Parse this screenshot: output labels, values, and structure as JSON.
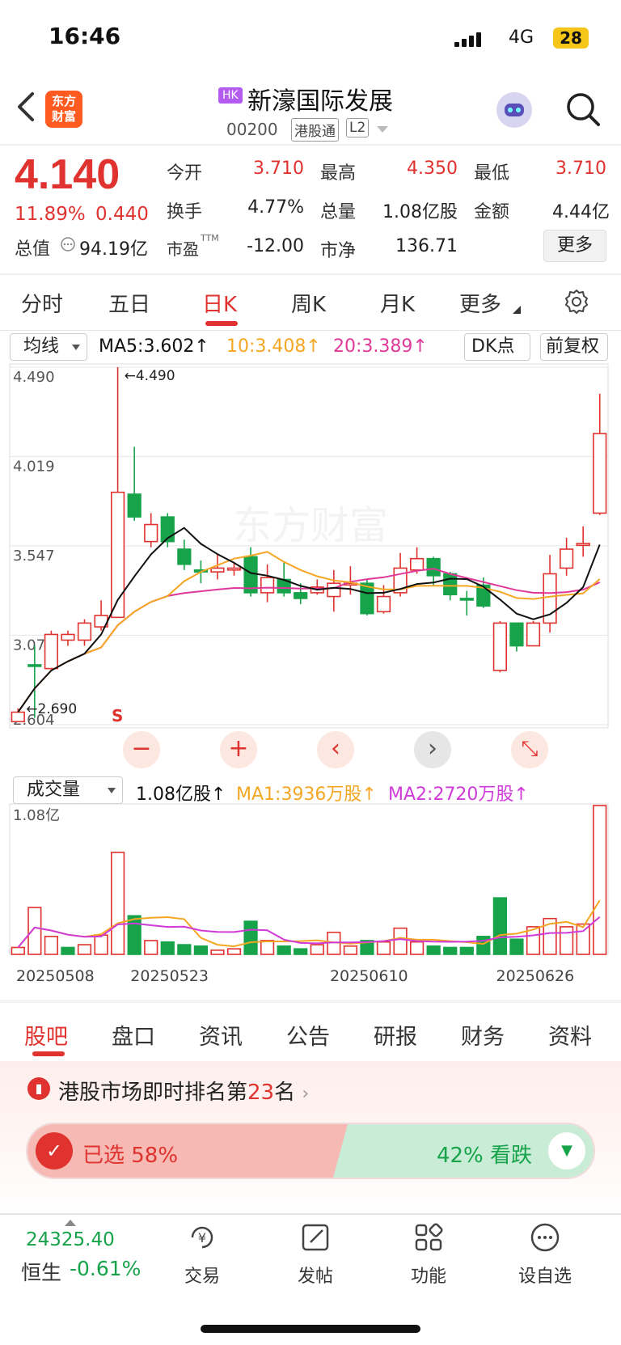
{
  "status_bar": {
    "time": "16:46",
    "network": "4G",
    "battery": "28"
  },
  "header": {
    "logo_line1": "东方",
    "logo_line2": "财富",
    "market_badge": "HK",
    "stock_name": "新濠国际发展",
    "stock_code": "00200",
    "tag_connect": "港股通",
    "tag_level": "L2"
  },
  "quote": {
    "price": "4.140",
    "change_pct": "11.89%",
    "change_amt": "0.440",
    "market_cap_label": "总值",
    "market_cap": "94.19亿",
    "open_label": "今开",
    "open": "3.710",
    "high_label": "最高",
    "high": "4.350",
    "low_label": "最低",
    "low": "3.710",
    "turnover_label": "换手",
    "turnover": "4.77%",
    "volume_label": "总量",
    "volume": "1.08亿股",
    "amount_label": "金额",
    "amount": "4.44亿",
    "pe_label": "市盈",
    "pe_sup": "TTM",
    "pe": "-12.00",
    "pb_label": "市净",
    "pb": "136.71",
    "more_label": "更多"
  },
  "tabs": [
    "分时",
    "五日",
    "日K",
    "周K",
    "月K",
    "更多"
  ],
  "indicators": {
    "selector": "均线",
    "ma5": "MA5:3.602↑",
    "ma10": "10:3.408↑",
    "ma20": "20:3.389↑",
    "dk_label": "DK点",
    "adjust_label": "前复权",
    "vol_selector": "成交量",
    "vol_total": "1.08亿股↑",
    "vol_ma1": "MA1:3936万股↑",
    "vol_ma2": "MA2:2720万股↑"
  },
  "colors": {
    "up": "#e0322e",
    "down": "#16a34a",
    "ma5": "#111111",
    "ma10": "#f5a623",
    "ma20": "#e0389a"
  },
  "chart_data": [
    {
      "type": "candlestick",
      "y_ticks": [
        "4.490",
        "4.019",
        "3.547",
        "3.076",
        "2.604"
      ],
      "ylim": [
        2.604,
        4.49
      ],
      "annotations": {
        "max_marker": "←4.490",
        "min_marker": "←2.690",
        "signal_label": "S"
      },
      "candles": [
        [
          2.62,
          2.67,
          2.69,
          2.62,
          "up"
        ],
        [
          2.92,
          2.92,
          3.02,
          2.64,
          "down"
        ],
        [
          2.9,
          3.08,
          3.1,
          2.9,
          "up"
        ],
        [
          3.05,
          3.08,
          3.1,
          3.02,
          "up"
        ],
        [
          3.05,
          3.14,
          3.16,
          3.02,
          "up"
        ],
        [
          3.12,
          3.18,
          3.26,
          3.1,
          "up"
        ],
        [
          3.17,
          3.83,
          4.49,
          3.17,
          "up"
        ],
        [
          3.82,
          3.7,
          4.07,
          3.68,
          "down"
        ],
        [
          3.57,
          3.66,
          3.72,
          3.54,
          "up"
        ],
        [
          3.7,
          3.57,
          3.72,
          3.54,
          "down"
        ],
        [
          3.53,
          3.45,
          3.58,
          3.42,
          "down"
        ],
        [
          3.42,
          3.41,
          3.47,
          3.35,
          "down"
        ],
        [
          3.41,
          3.43,
          3.5,
          3.37,
          "up"
        ],
        [
          3.42,
          3.43,
          3.46,
          3.39,
          "up"
        ],
        [
          3.49,
          3.3,
          3.54,
          3.28,
          "down"
        ],
        [
          3.3,
          3.38,
          3.45,
          3.25,
          "up"
        ],
        [
          3.37,
          3.3,
          3.46,
          3.28,
          "down"
        ],
        [
          3.3,
          3.27,
          3.35,
          3.24,
          "down"
        ],
        [
          3.3,
          3.33,
          3.37,
          3.29,
          "up"
        ],
        [
          3.28,
          3.35,
          3.42,
          3.2,
          "up"
        ],
        [
          3.35,
          3.35,
          3.44,
          3.29,
          "up"
        ],
        [
          3.35,
          3.19,
          3.37,
          3.18,
          "down"
        ],
        [
          3.2,
          3.28,
          3.34,
          3.19,
          "up"
        ],
        [
          3.3,
          3.43,
          3.51,
          3.28,
          "up"
        ],
        [
          3.42,
          3.48,
          3.54,
          3.4,
          "up"
        ],
        [
          3.48,
          3.39,
          3.49,
          3.34,
          "down"
        ],
        [
          3.4,
          3.29,
          3.41,
          3.26,
          "down"
        ],
        [
          3.27,
          3.27,
          3.31,
          3.18,
          "down"
        ],
        [
          3.34,
          3.23,
          3.38,
          3.22,
          "down"
        ],
        [
          2.89,
          3.14,
          3.15,
          2.88,
          "up"
        ],
        [
          3.14,
          3.02,
          3.14,
          2.99,
          "down"
        ],
        [
          3.02,
          3.14,
          3.15,
          3.02,
          "up"
        ],
        [
          3.14,
          3.4,
          3.5,
          3.09,
          "up"
        ],
        [
          3.43,
          3.53,
          3.59,
          3.39,
          "up"
        ],
        [
          3.55,
          3.56,
          3.65,
          3.49,
          "up"
        ],
        [
          3.72,
          4.14,
          4.35,
          3.71,
          "up"
        ]
      ]
    },
    {
      "type": "bar",
      "y_ticks": [
        "1.08亿"
      ],
      "x_ticks": [
        "20250508",
        "20250523",
        "20250610",
        "20250626"
      ],
      "volumes": [
        [
          0.05,
          "up"
        ],
        [
          0.34,
          "up"
        ],
        [
          0.13,
          "up"
        ],
        [
          0.05,
          "down"
        ],
        [
          0.07,
          "up"
        ],
        [
          0.14,
          "up"
        ],
        [
          0.74,
          "up"
        ],
        [
          0.28,
          "down"
        ],
        [
          0.1,
          "up"
        ],
        [
          0.09,
          "down"
        ],
        [
          0.07,
          "down"
        ],
        [
          0.06,
          "down"
        ],
        [
          0.03,
          "up"
        ],
        [
          0.04,
          "up"
        ],
        [
          0.24,
          "down"
        ],
        [
          0.1,
          "up"
        ],
        [
          0.06,
          "down"
        ],
        [
          0.04,
          "down"
        ],
        [
          0.07,
          "up"
        ],
        [
          0.16,
          "up"
        ],
        [
          0.06,
          "up"
        ],
        [
          0.1,
          "down"
        ],
        [
          0.09,
          "up"
        ],
        [
          0.19,
          "up"
        ],
        [
          0.09,
          "up"
        ],
        [
          0.06,
          "down"
        ],
        [
          0.05,
          "down"
        ],
        [
          0.05,
          "down"
        ],
        [
          0.13,
          "down"
        ],
        [
          0.41,
          "down"
        ],
        [
          0.11,
          "down"
        ],
        [
          0.2,
          "up"
        ],
        [
          0.26,
          "up"
        ],
        [
          0.2,
          "up"
        ],
        [
          0.22,
          "up"
        ],
        [
          1.08,
          "up"
        ]
      ]
    }
  ],
  "chart_controls": {
    "zoom_out": "−",
    "zoom_in": "+",
    "prev": "‹",
    "next": "›",
    "fullscreen": "⤡"
  },
  "bottom_tabs": [
    "股吧",
    "盘口",
    "资讯",
    "公告",
    "研报",
    "财务",
    "资料"
  ],
  "ranking": {
    "text_prefix": "港股市场即时排名第",
    "rank": "23",
    "text_suffix": "名"
  },
  "vote": {
    "up_label": "已选  58%",
    "up_pct": 58,
    "down_label": "42%  看跌",
    "down_pct": 42
  },
  "index": {
    "value": "24325.40",
    "name": "恒生",
    "change": "-0.61%"
  },
  "bottom_nav": [
    "交易",
    "发帖",
    "功能",
    "设自选"
  ]
}
